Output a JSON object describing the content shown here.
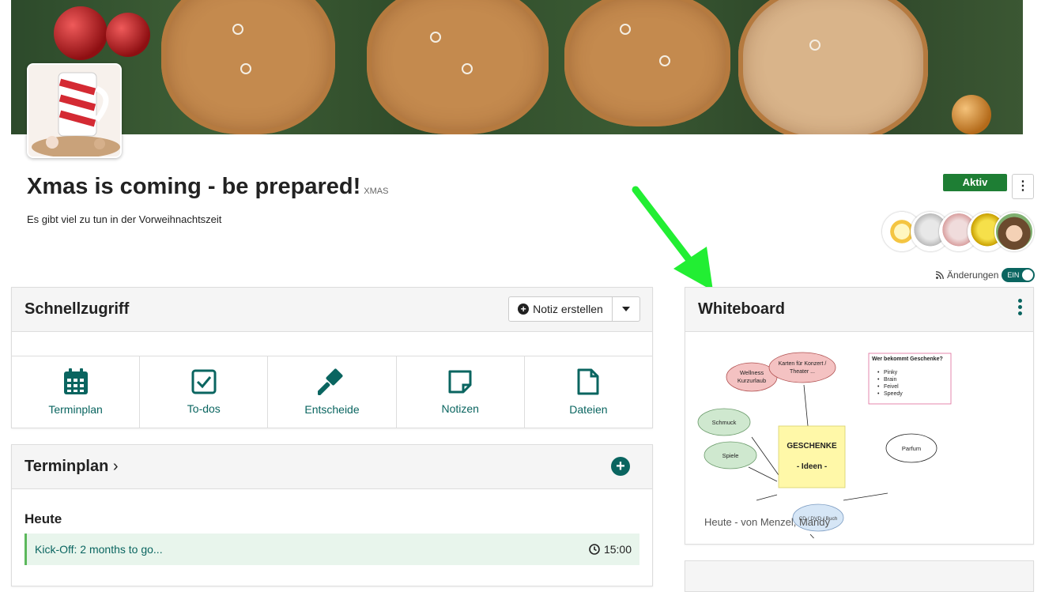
{
  "group": {
    "title": "Xmas is coming - be prepared!",
    "tag": "XMAS",
    "description": "Es gibt viel zu tun in der Vorweihnachtszeit",
    "status": "Aktiv"
  },
  "changes": {
    "label": "Änderungen",
    "toggle": "EIN"
  },
  "quickaccess": {
    "title": "Schnellzugriff",
    "note_button": "Notiz erstellen",
    "tiles": [
      {
        "label": "Terminplan",
        "icon": "calendar-icon"
      },
      {
        "label": "To-dos",
        "icon": "checkbox-icon"
      },
      {
        "label": "Entscheide",
        "icon": "gavel-icon"
      },
      {
        "label": "Notizen",
        "icon": "note-icon"
      },
      {
        "label": "Dateien",
        "icon": "file-icon"
      }
    ]
  },
  "schedule": {
    "title": "Terminplan",
    "day": "Heute",
    "event": "Kick-Off: 2 months to go...",
    "time": "15:00"
  },
  "whiteboard": {
    "title": "Whiteboard",
    "center_line1": "GESCHENKE",
    "center_line2": "- Ideen -",
    "nodes": {
      "wellness": "Wellness Kurzurlaub",
      "konzert_a": "Karten für Konzert /",
      "konzert_b": "Theater ...",
      "schmuck": "Schmuck",
      "spiele": "Spiele",
      "parfum": "Parfum",
      "cd": "CD / DVD / Buch"
    },
    "list_title": "Wer bekommt Geschenke?",
    "list_items": [
      "Pinky",
      "Brain",
      "Feivel",
      "Speedy"
    ],
    "caption": "Heute - von Menzel, Mandy"
  },
  "colors": {
    "accent": "#0a6560",
    "status": "#1e7e34",
    "arrow": "#22ee33"
  }
}
